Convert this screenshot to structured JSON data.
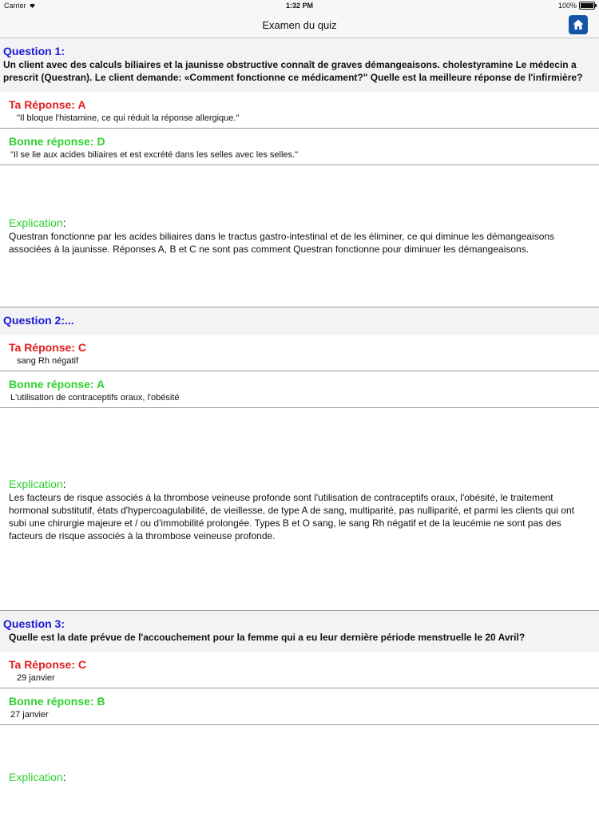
{
  "status_bar": {
    "carrier": "Carrier",
    "time": "1:32 PM",
    "battery": "100%",
    "battery_level": 1.0
  },
  "nav": {
    "title": "Examen du quiz"
  },
  "labels": {
    "your_answer": "Ta Réponse:",
    "correct_answer": "Bonne réponse:",
    "explanation": "Explication"
  },
  "questions": [
    {
      "title": "Question 1:",
      "text": "Un client avec des calculs biliaires et la jaunisse obstructive connaît de graves démangeaisons. cholestyramine Le médecin a prescrit (Questran). Le client demande: «Comment fonctionne ce médicament?\" Quelle est la meilleure réponse de l'infirmière?",
      "your_answer_letter": "A",
      "your_answer_text": "\"Il bloque l'histamine, ce qui réduit la réponse allergique.\"",
      "correct_answer_letter": "D",
      "correct_answer_text": "\"Il se lie aux acides biliaires et est excrété dans les selles avec les selles.\"",
      "explanation": " Questran fonctionne par les acides biliaires dans le tractus gastro-intestinal et de les éliminer, ce qui diminue les démangeaisons associées à la jaunisse. Réponses A, B et C ne sont pas comment Questran fonctionne pour diminuer les démangeaisons."
    },
    {
      "title": "Question 2:...",
      "text": "",
      "your_answer_letter": "C",
      "your_answer_text": "sang Rh négatif",
      "correct_answer_letter": "A",
      "correct_answer_text": "L'utilisation de contraceptifs oraux, l'obésité",
      "explanation": " Les facteurs de risque associés à la thrombose veineuse profonde sont l'utilisation de contraceptifs oraux, l'obésité, le traitement hormonal substitutif, états d'hypercoagulabilité, de vieillesse, de type A de sang, multiparité, pas nulliparité, et parmi les clients qui ont subi une chirurgie majeure et / ou d'immobilité prolongée. Types B et O sang, le sang Rh négatif et de la leucémie ne sont pas des facteurs de risque associés à la thrombose veineuse profonde."
    },
    {
      "title": "Question 3:",
      "text": "Quelle est la date prévue de l'accouchement pour la femme qui a eu leur dernière période menstruelle le 20 Avril?",
      "your_answer_letter": "C",
      "your_answer_text": "29 janvier",
      "correct_answer_letter": "B",
      "correct_answer_text": "27 janvier",
      "explanation": ""
    }
  ]
}
